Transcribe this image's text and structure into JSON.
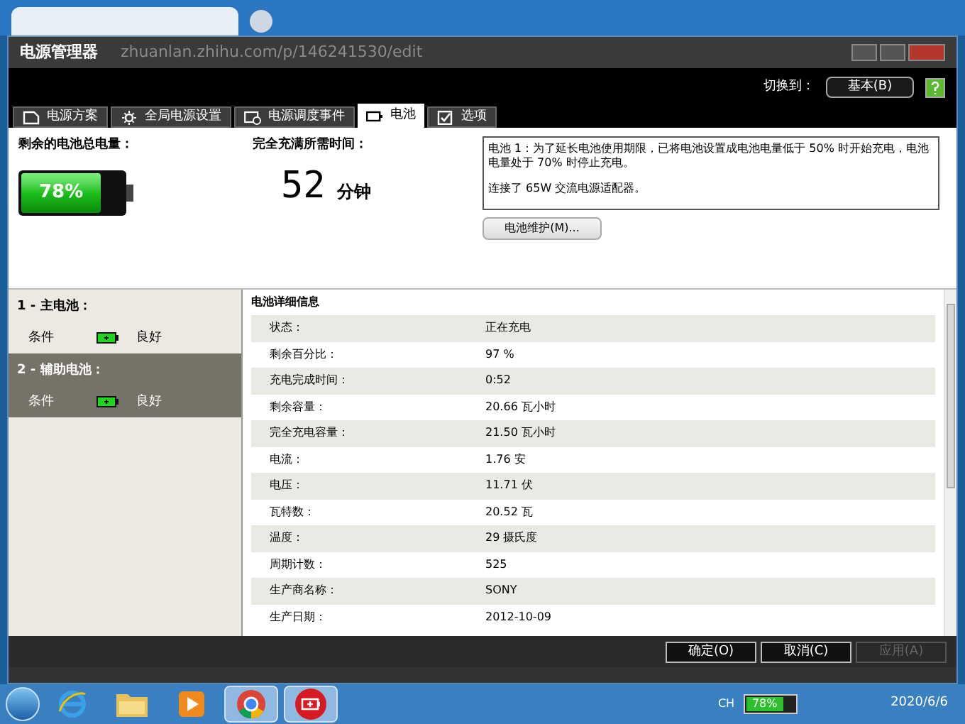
{
  "browser": {
    "url": "zhuanlan.zhihu.com/p/146241530/edit"
  },
  "window": {
    "title": "电源管理器"
  },
  "header": {
    "switch_label": "切换到：",
    "switch_button": "基本(B)"
  },
  "tabs": [
    {
      "label": "电源方案",
      "kind": "plan",
      "selected": false
    },
    {
      "label": "全局电源设置",
      "kind": "gear",
      "selected": false
    },
    {
      "label": "电源调度事件",
      "kind": "schedule",
      "selected": false
    },
    {
      "label": "电池",
      "kind": "battery",
      "selected": true
    },
    {
      "label": "选项",
      "kind": "check",
      "selected": false
    }
  ],
  "summary": {
    "remaining_label": "剩余的电池总电量：",
    "remaining_text": "78%",
    "level": 0.78,
    "charge_time_label": "完全充满所需时间：",
    "charge_time_value": "52",
    "charge_time_unit": "分钟",
    "info": [
      "电池 1：为了延长电池使用期限，已将电池设置成电池电量低于 50% 时开始充电，电池电量处于 70% 时停止充电。",
      "连接了 65W 交流电源适配器。"
    ],
    "maintenance_button": "电池维护(M)..."
  },
  "batteries": [
    {
      "title": "1 - 主电池：",
      "condition_label": "条件",
      "condition": "良好",
      "selected": false
    },
    {
      "title": "2 - 辅助电池：",
      "condition_label": "条件",
      "condition": "良好",
      "selected": true
    }
  ],
  "details": {
    "title": "电池详细信息",
    "rows": [
      {
        "label": "状态：",
        "value": "正在充电"
      },
      {
        "label": "剩余百分比：",
        "value": "97 %"
      },
      {
        "label": "充电完成时间：",
        "value": "0:52"
      },
      {
        "label": "剩余容量：",
        "value": "20.66 瓦小时"
      },
      {
        "label": "完全充电容量：",
        "value": "21.50 瓦小时"
      },
      {
        "label": "电流：",
        "value": "1.76 安"
      },
      {
        "label": "电压：",
        "value": "11.71 伏"
      },
      {
        "label": "瓦特数：",
        "value": "20.52 瓦"
      },
      {
        "label": "温度：",
        "value": "29 摄氏度"
      },
      {
        "label": "周期计数：",
        "value": "525"
      },
      {
        "label": "生产商名称：",
        "value": "SONY"
      },
      {
        "label": "生产日期：",
        "value": "2012-10-09"
      }
    ]
  },
  "footer_buttons": [
    {
      "label": "确定(O)",
      "disabled": false
    },
    {
      "label": "取消(C)",
      "disabled": false
    },
    {
      "label": "应用(A)",
      "disabled": true
    }
  ],
  "taskbar": {
    "apps": [
      {
        "kind": "ie",
        "selected": false
      },
      {
        "kind": "folder",
        "selected": false
      },
      {
        "kind": "media",
        "selected": false
      },
      {
        "kind": "chrome",
        "selected": true
      },
      {
        "kind": "battery",
        "selected": true
      }
    ],
    "tray": {
      "language": "CH",
      "battery_text": "78%",
      "level": 0.78,
      "date": "2020/6/6"
    }
  }
}
